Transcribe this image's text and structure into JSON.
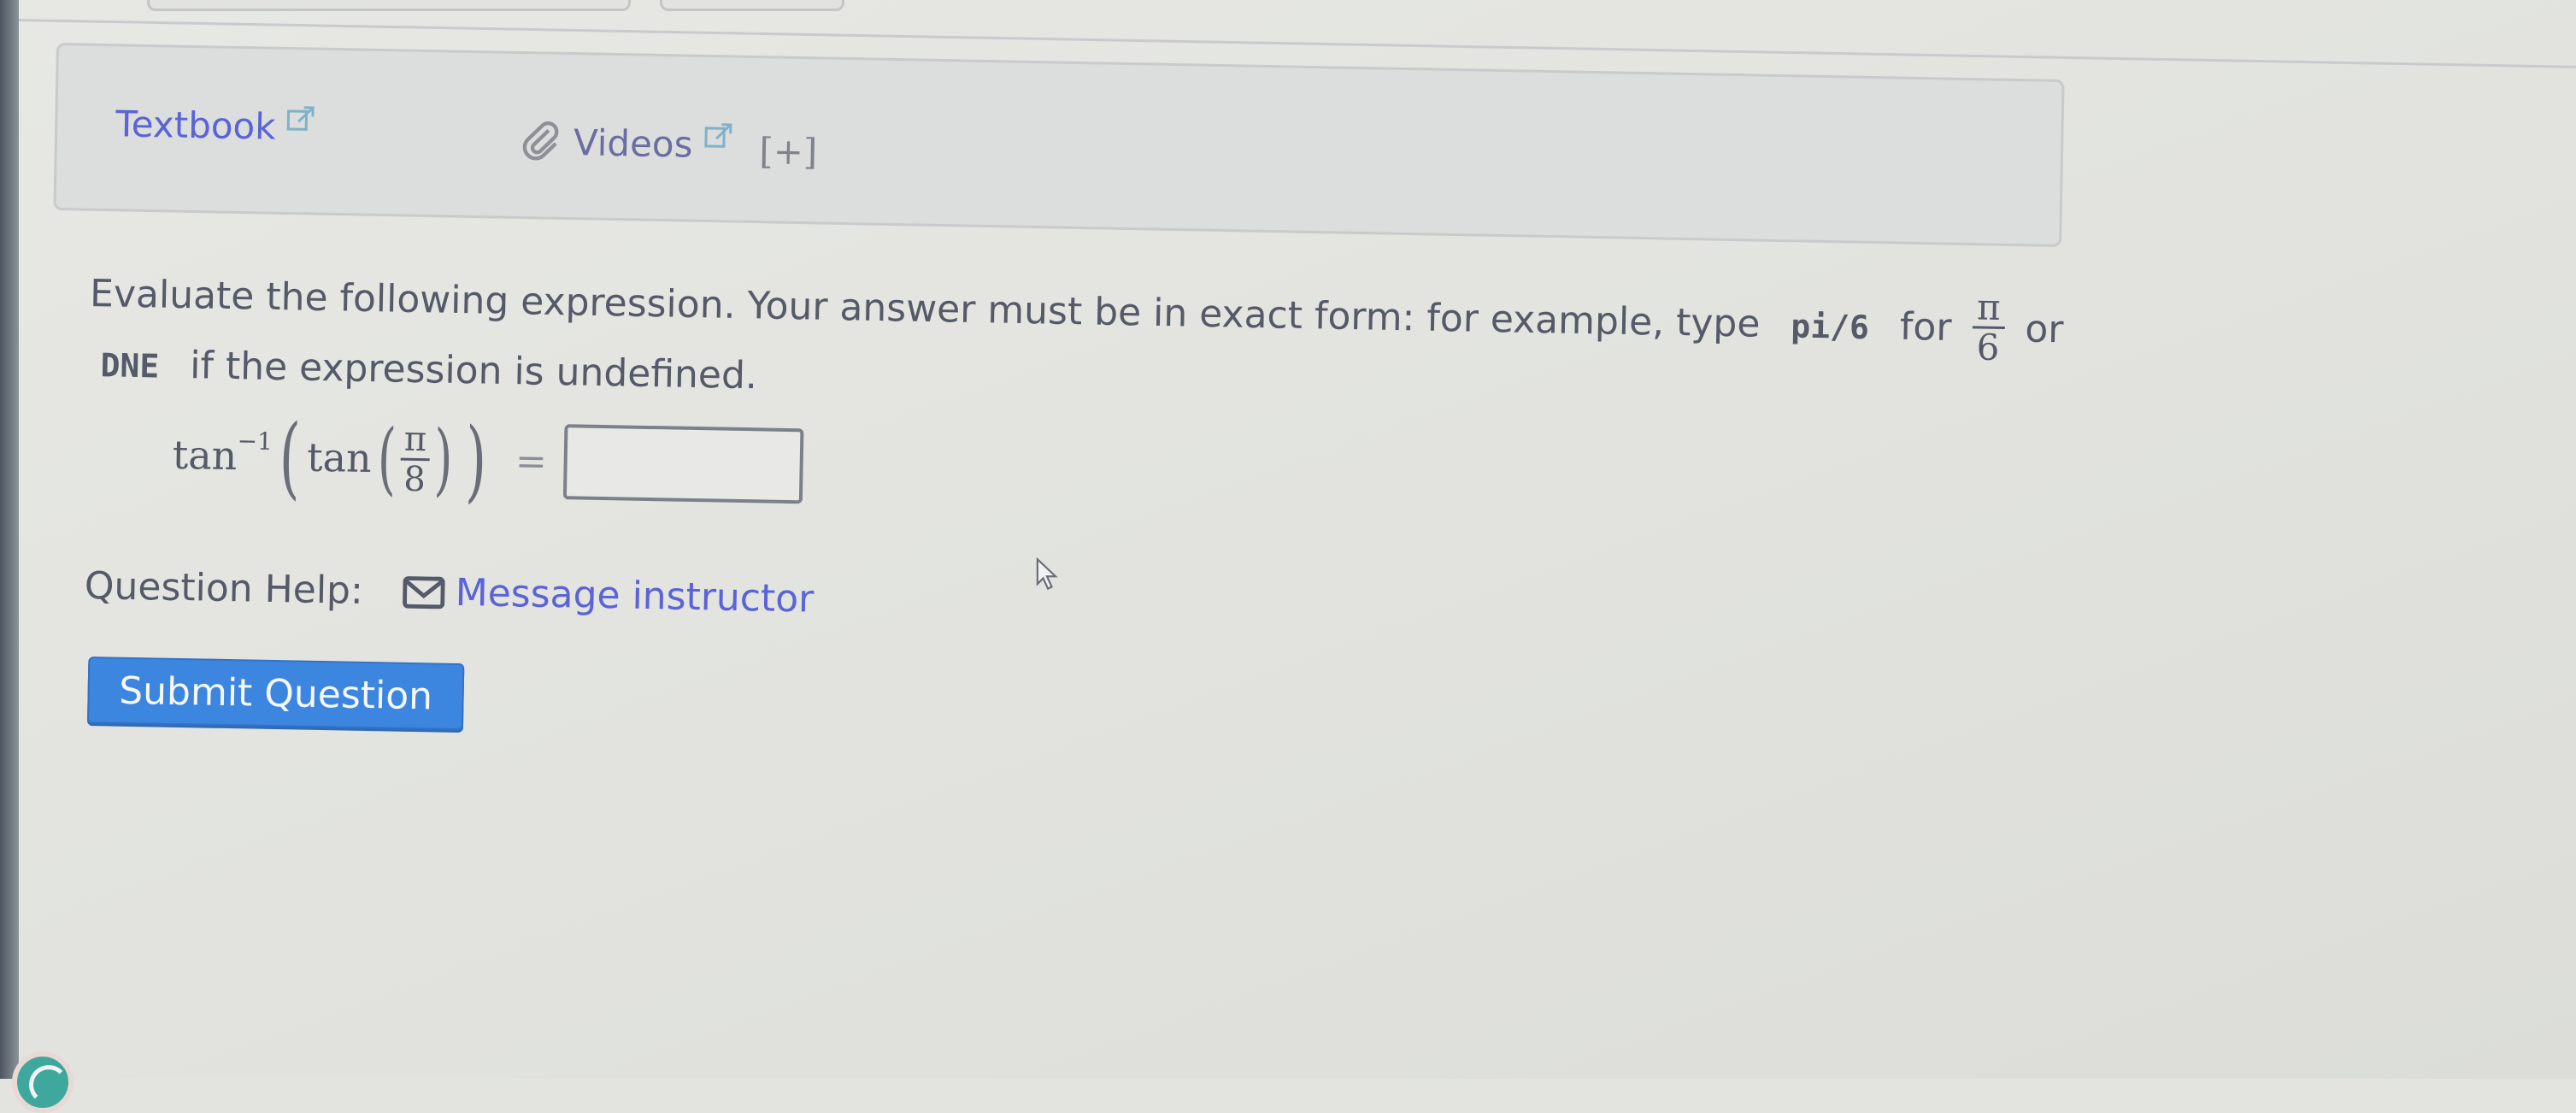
{
  "resources": {
    "textbook_label": "Textbook",
    "videos_label": "Videos",
    "expand_label": "[+]",
    "icons": {
      "external_link": "external-link-icon",
      "videos": "paperclip-icon"
    }
  },
  "question": {
    "instruction_part1": "Evaluate the following expression. Your answer must be in exact form: for example, type",
    "example_code": "pi/6",
    "instruction_part2": "for",
    "example_fraction": {
      "numerator": "π",
      "denominator": "6"
    },
    "instruction_part3": "or",
    "dne_code": "DNE",
    "instruction_part4": "if the expression is undefined.",
    "expression": {
      "outer_func": "tan",
      "outer_exponent": "−1",
      "inner_func": "tan",
      "numerator": "π",
      "denominator": "8",
      "equals": "="
    },
    "answer": {
      "value": "",
      "placeholder": ""
    }
  },
  "help": {
    "label": "Question Help:",
    "message_link": "Message instructor",
    "icon": "mail-icon"
  },
  "actions": {
    "submit_label": "Submit Question"
  },
  "colors": {
    "link": "#5a63d8",
    "primary_button": "#3d86e0",
    "text": "#555a68"
  }
}
